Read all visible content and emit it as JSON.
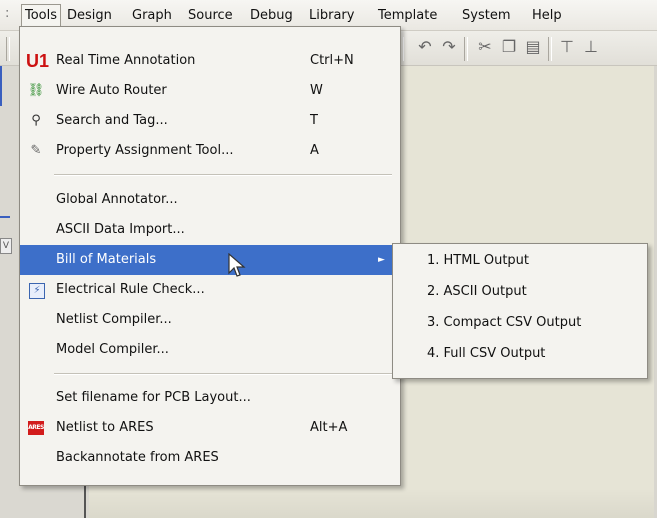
{
  "menubar": {
    "lead": ":",
    "items": [
      {
        "label": "Tools"
      },
      {
        "label": "Design"
      },
      {
        "label": "Graph"
      },
      {
        "label": "Source"
      },
      {
        "label": "Debug"
      },
      {
        "label": "Library"
      },
      {
        "label": "Template"
      },
      {
        "label": "System"
      },
      {
        "label": "Help"
      }
    ]
  },
  "toolbar": {
    "icons": [
      "undo-icon",
      "redo-icon",
      "cut-icon",
      "copy-icon",
      "paste-icon",
      "align-top-icon",
      "align-bottom-icon"
    ]
  },
  "tools_menu": {
    "items": [
      {
        "icon": "U1",
        "label": "Real Time Annotation",
        "shortcut": "Ctrl+N"
      },
      {
        "icon": "",
        "label": "Wire Auto Router",
        "shortcut": "W"
      },
      {
        "icon": "",
        "label": "Search and Tag...",
        "shortcut": "T"
      },
      {
        "icon": "",
        "label": "Property Assignment Tool...",
        "shortcut": "A"
      },
      {
        "label": "Global Annotator..."
      },
      {
        "label": "ASCII Data Import..."
      },
      {
        "label": "Bill of Materials",
        "arrow": "►"
      },
      {
        "icon": "",
        "label": "Electrical Rule Check..."
      },
      {
        "label": "Netlist Compiler..."
      },
      {
        "label": "Model Compiler..."
      },
      {
        "label": "Set filename for PCB Layout..."
      },
      {
        "icon": "ARES",
        "label": "Netlist to ARES",
        "shortcut": "Alt+A"
      },
      {
        "label": "Backannotate from ARES"
      }
    ]
  },
  "bom_submenu": {
    "items": [
      {
        "label": "1. HTML Output"
      },
      {
        "label": "2. ASCII Output"
      },
      {
        "label": "3. Compact CSV Output"
      },
      {
        "label": "4. Full CSV Output"
      }
    ]
  },
  "colors": {
    "highlight": "#3d6fc9",
    "menu_bg": "#f4f3ef",
    "canvas": "#e6e4d6"
  }
}
